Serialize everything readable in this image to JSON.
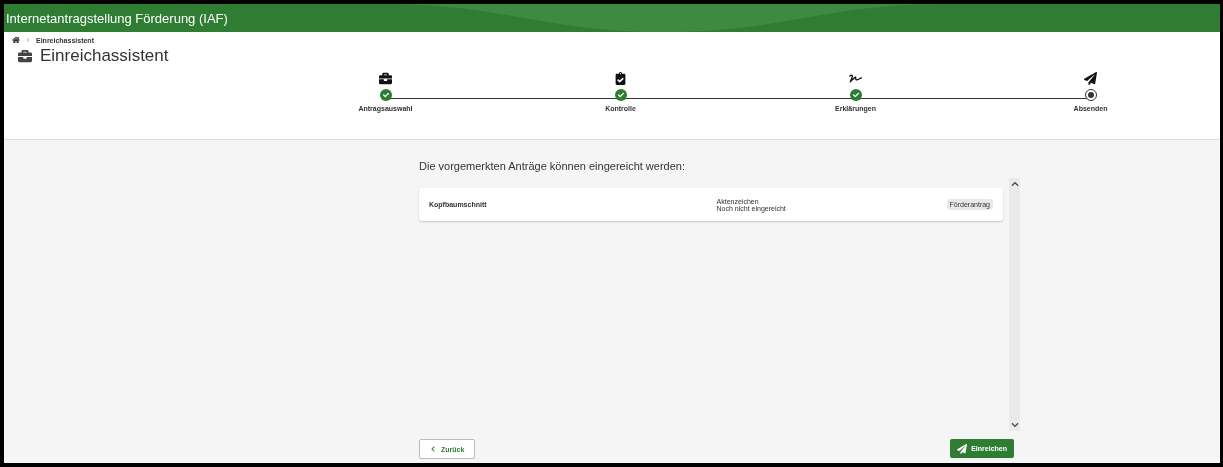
{
  "header": {
    "title": "Internetantragstellung Förderung (IAF)"
  },
  "breadcrumb": {
    "items": [
      "Einreichassistent"
    ]
  },
  "page_title": "Einreichassistent",
  "stepper": [
    {
      "label": "Antragsauswahl",
      "completed": true
    },
    {
      "label": "Kontrolle",
      "completed": true
    },
    {
      "label": "Erklärungen",
      "completed": true
    },
    {
      "label": "Absenden",
      "completed": false
    }
  ],
  "intro": "Die vorgemerkten Anträge können eingereicht werden:",
  "applications": [
    {
      "name": "Kopfbaumschnitt",
      "file_number_label": "Aktenzeichen",
      "status": "Noch nicht eingereicht",
      "type": "Förderantrag"
    }
  ],
  "buttons": {
    "back": "Zurück",
    "submit": "Einreichen"
  }
}
